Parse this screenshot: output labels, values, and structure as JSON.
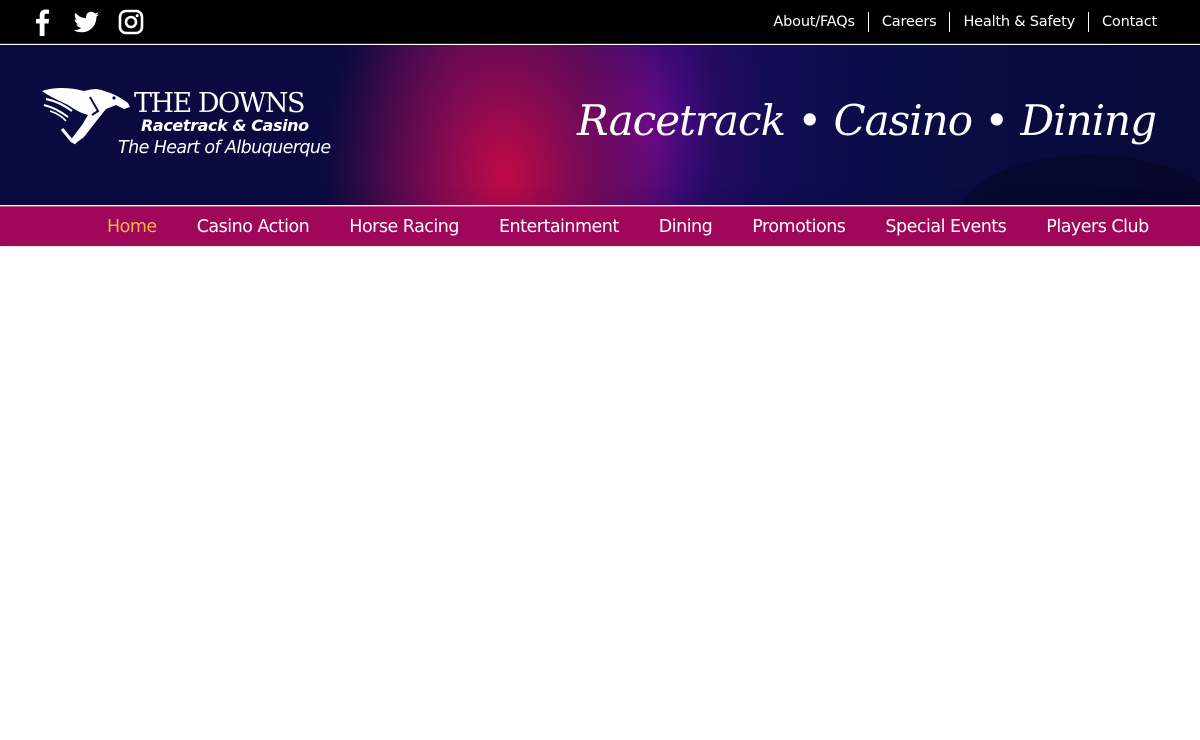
{
  "social": [
    {
      "icon": "facebook-icon"
    },
    {
      "icon": "twitter-icon"
    },
    {
      "icon": "instagram-icon"
    }
  ],
  "utility_nav": [
    "About/FAQs",
    "Careers",
    "Health & Safety",
    "Contact"
  ],
  "logo": {
    "title": "THE DOWNS",
    "subtitle": "Racetrack & Casino",
    "tagline": "The Heart of Albuquerque"
  },
  "banner_tagline": "Racetrack • Casino • Dining",
  "main_nav": [
    {
      "label": "Home",
      "active": true
    },
    {
      "label": "Casino Action"
    },
    {
      "label": "Horse Racing"
    },
    {
      "label": "Entertainment"
    },
    {
      "label": "Dining"
    },
    {
      "label": "Promotions"
    },
    {
      "label": "Special Events"
    },
    {
      "label": "Players Club"
    }
  ],
  "colors": {
    "topbar": "#000000",
    "banner_base": "#0a0c45",
    "nav_bar": "#a0065a",
    "nav_active": "#f6b24a"
  }
}
